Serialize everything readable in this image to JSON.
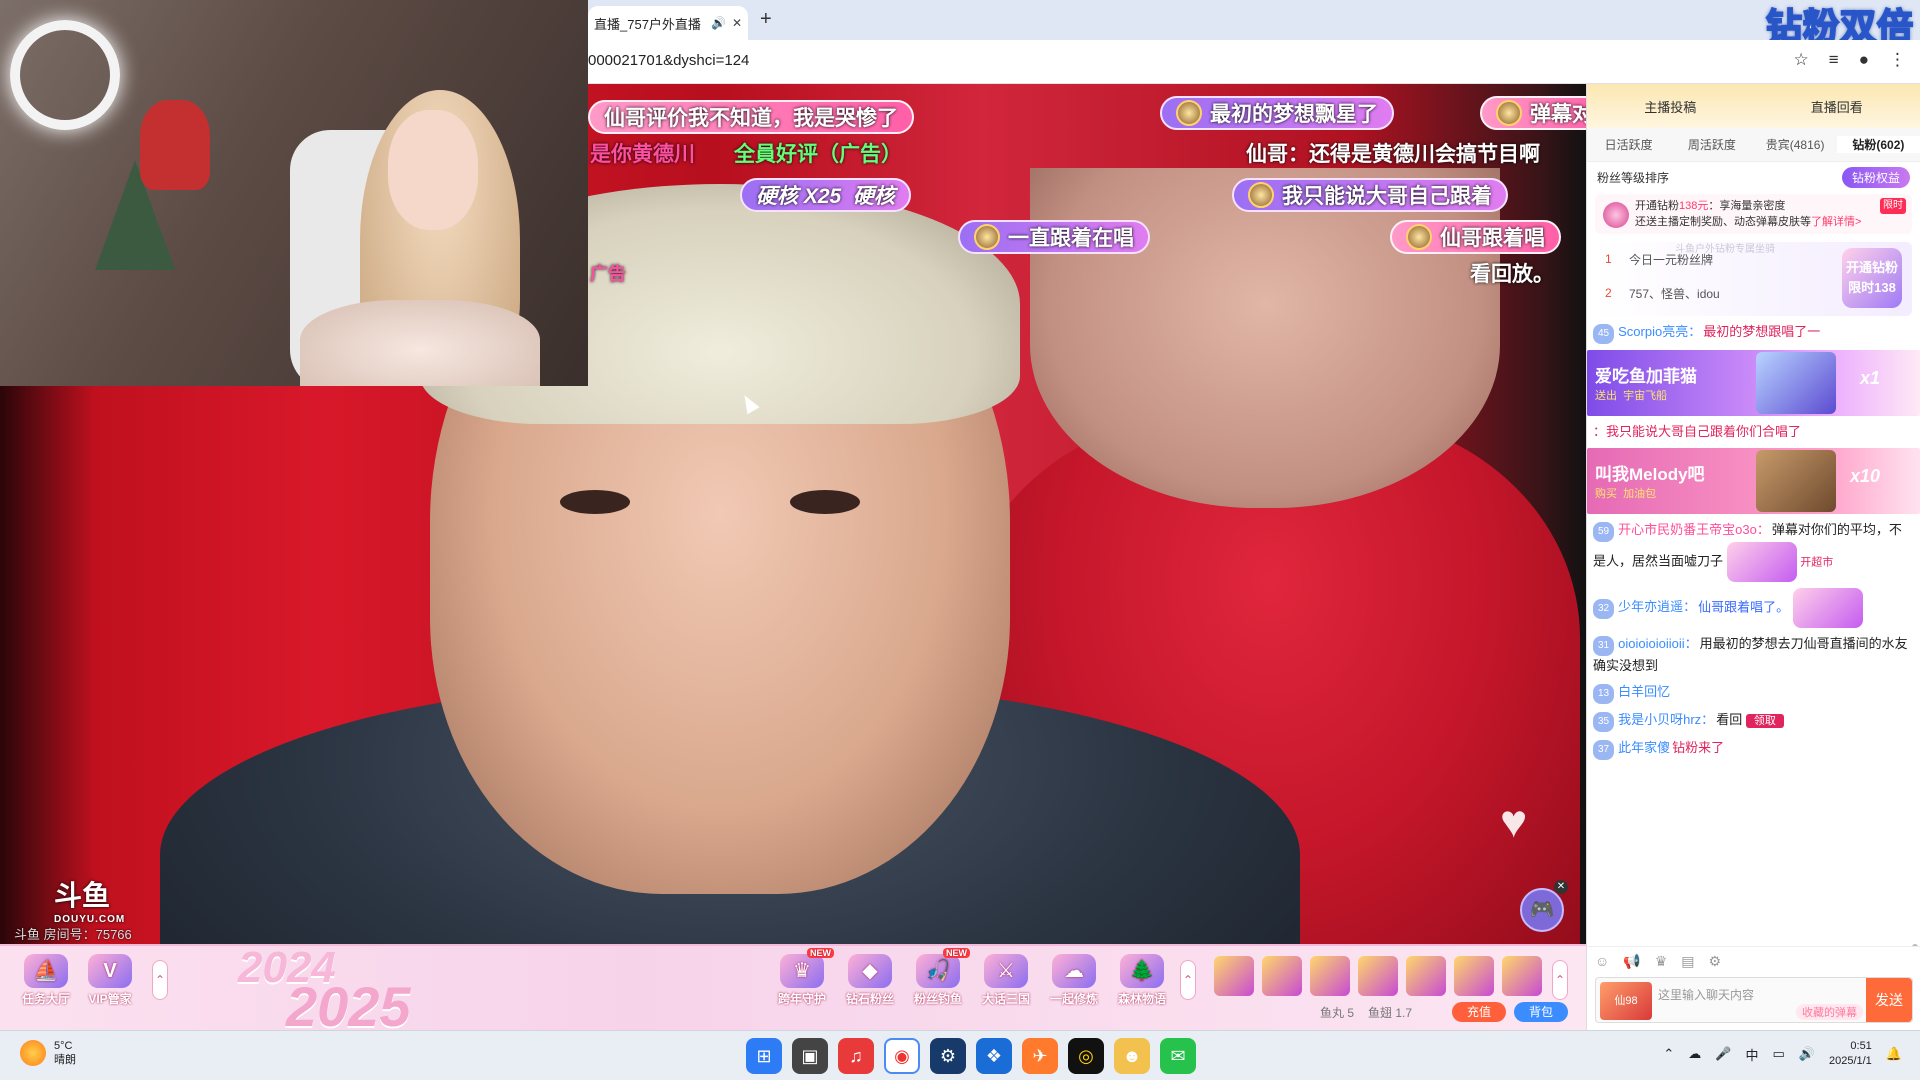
{
  "browser": {
    "tab_title": "直播_757户外直播",
    "tab_audio_icon": "speaker-icon",
    "url": "000021701&dyshci=124",
    "corner_badge": "钻粉双倍"
  },
  "video": {
    "watermark": "斗鱼",
    "watermark_sub": "DOUYU.COM",
    "room_label": "斗鱼 房间号：75766",
    "danmaku": [
      "仙哥评价我不知道，我是哭惨了",
      "最初的梦想飘星了",
      "弹幕对",
      "是你黄德川",
      "全員好评（广告）",
      "仙哥：还得是黄德川会搞节目啊",
      "硬核 X25",
      "硬核",
      "我只能说大哥自己跟着",
      "一直跟着在唱",
      "仙哥跟着唱",
      "广告",
      "看回放。"
    ]
  },
  "bottombar": {
    "task_hall": "任务大厅",
    "vip": "VIP管家",
    "year_a": "2024",
    "year_b": "2025",
    "items": [
      {
        "label": "跨年守护",
        "new": "NEW"
      },
      {
        "label": "钻石粉丝",
        "new": ""
      },
      {
        "label": "粉丝钓鱼",
        "new": "NEW"
      },
      {
        "label": "大话三国",
        "new": ""
      },
      {
        "label": "一起修炼",
        "new": ""
      },
      {
        "label": "森林物语",
        "new": ""
      }
    ],
    "fishball": "鱼丸 5",
    "fishwing": "鱼翅 1.7",
    "charge": "充值",
    "bag": "背包"
  },
  "rightpanel": {
    "top_left": "主播投稿",
    "top_right": "直播回看",
    "tabs": [
      "日活跃度",
      "周活跃度",
      "贵宾(4816)",
      "钻粉(602)"
    ],
    "sort_label": "粉丝等级排序",
    "fan_btn": "钻粉权益",
    "promo_line1_a": "开通钻粉",
    "promo_price": "138元",
    "promo_line1_b": "：享海量亲密度",
    "promo_line2": "还送主播定制奖励、动态弹幕皮肤等",
    "promo_link": "了解详情>",
    "promo_limit": "限时",
    "rank_watermark": "斗鱼户外钻粉专属坐骑",
    "rank": [
      {
        "num": "1",
        "name": "今日一元粉丝牌"
      },
      {
        "num": "2",
        "name": "757、怪兽、idou"
      }
    ],
    "rank_badge": "开通钻粉 限时138",
    "messages": [
      {
        "lvl": "45",
        "nick": "Scorpio亮亮：",
        "text": "最初的梦想跟唱了一"
      },
      {
        "lvl": "59",
        "nick": "开心市民奶番王帝宝o3o：",
        "text": "弹幕对你们的平均，不是人，居然当面嘘刀子"
      },
      {
        "lvl": "32",
        "nick": "少年亦逍遥：",
        "text": "仙哥跟着唱了。"
      },
      {
        "lvl": "31",
        "nick": "oioioioioiioii：",
        "text": "用最初的梦想去刀仙哥直播间的水友确实没想到"
      },
      {
        "lvl": "13",
        "nick": "白羊回忆",
        "text": ""
      },
      {
        "lvl": "35",
        "nick": "我是小贝呀hrz：",
        "text": "看回"
      },
      {
        "lvl": "37",
        "nick": "此年家傻",
        "text": "钻粉来了"
      }
    ],
    "banner1_title": "爱吃鱼加菲猫",
    "banner1_sub_a": "送出",
    "banner1_sub_b": "宇宙飞船",
    "banner1_cnt": "x1",
    "banner2_title": "叫我Melody吧",
    "banner2_sub_a": "购买",
    "banner2_sub_b": "加油包",
    "banner2_cnt": "x10",
    "red_line": "：我只能说大哥自己跟着你们合唱了",
    "claim": "领取",
    "open_btn": "开超市",
    "input_placeholder": "这里输入聊天内容",
    "input_pill": "收藏的弹幕",
    "avatar_label": "仙98",
    "send": "发送"
  },
  "taskbar": {
    "temp": "5°C",
    "weather": "晴朗",
    "time": "0:51",
    "date": "2025/1/1",
    "ime": "中"
  }
}
